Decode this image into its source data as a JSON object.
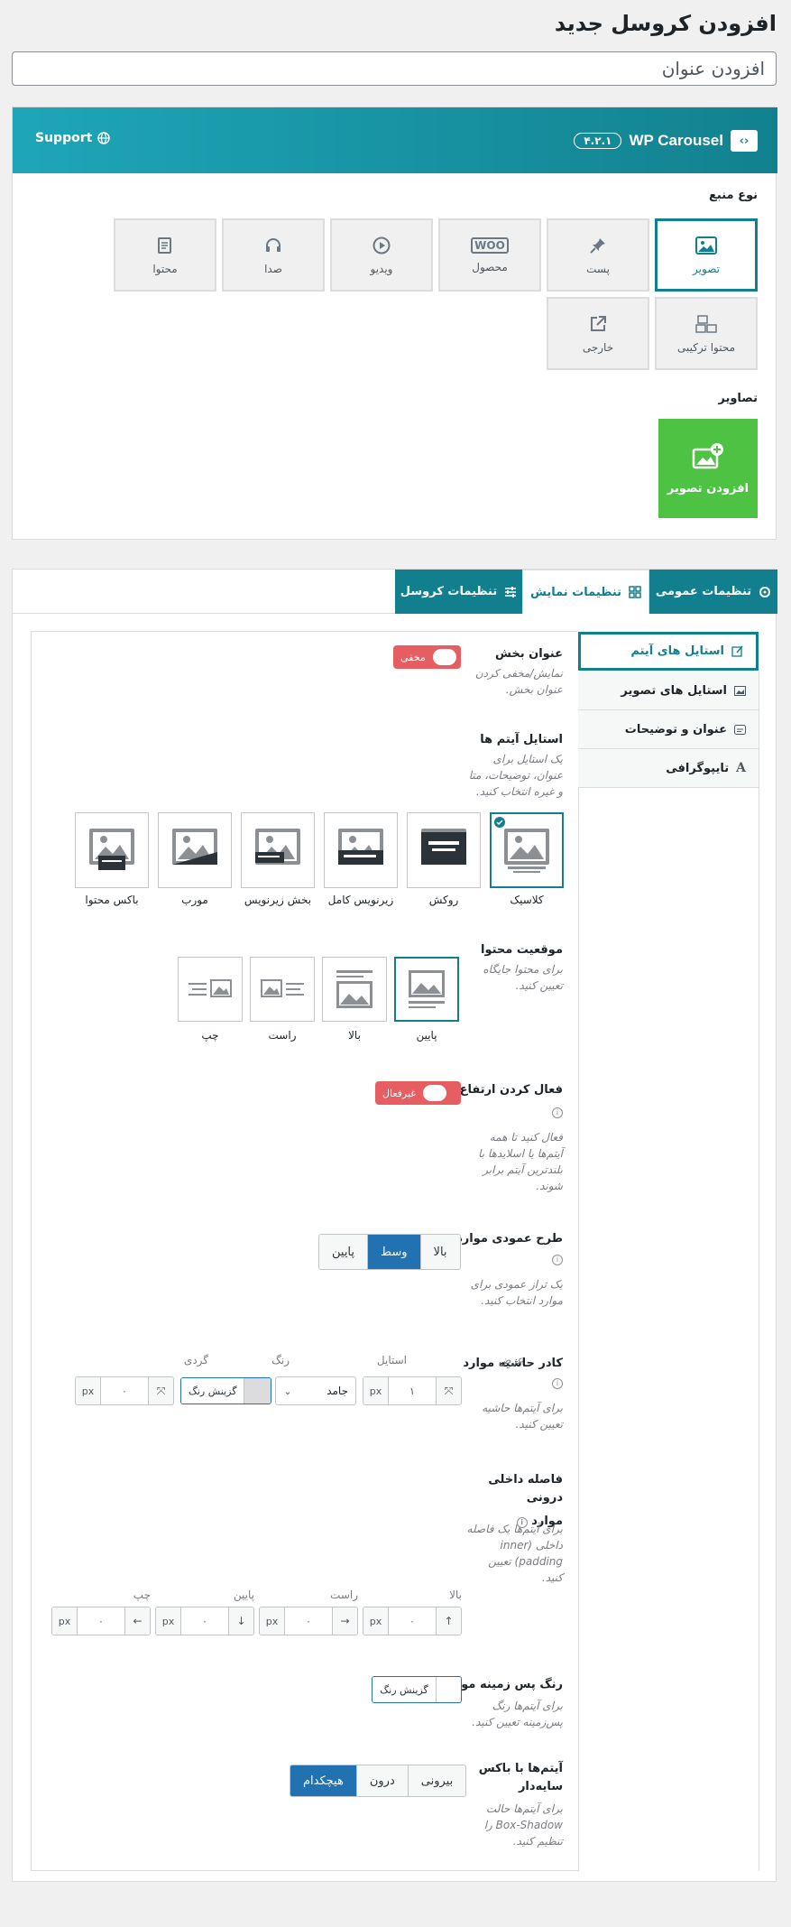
{
  "page": {
    "title": "افزودن کروسل جدید",
    "title_input_value": "افزودن عنوان"
  },
  "header": {
    "brand": "WP Carousel",
    "version": "۴.۲.۱",
    "support": "Support"
  },
  "source": {
    "label": "نوع منبع",
    "items": [
      {
        "label": "تصویر",
        "icon": "image-icon",
        "active": true
      },
      {
        "label": "پست",
        "icon": "pin-icon"
      },
      {
        "label": "محصول",
        "icon": "woo-icon",
        "icon_text": "WOO"
      },
      {
        "label": "ویدیو",
        "icon": "play-icon"
      },
      {
        "label": "صدا",
        "icon": "headphones-icon"
      },
      {
        "label": "محتوا",
        "icon": "content-icon"
      },
      {
        "label": "محتوا ترکیبی",
        "icon": "mixed-content-icon"
      },
      {
        "label": "خارجی",
        "icon": "external-link-icon"
      }
    ],
    "images_label": "تصاویر",
    "add_image": "افزودن تصویر"
  },
  "tabs": [
    {
      "label": "تنظیمات عمومی",
      "icon": "gear-icon"
    },
    {
      "label": "تنظیمات نمایش",
      "icon": "grid-icon",
      "active": true
    },
    {
      "label": "تنظیمات کروسل",
      "icon": "sliders-icon"
    }
  ],
  "sidebar": [
    {
      "label": "استایل های آیتم",
      "icon": "edit-icon",
      "active": true
    },
    {
      "label": "استایل های تصویر",
      "icon": "image-icon"
    },
    {
      "label": "عنوان و توضیحات",
      "icon": "caption-icon"
    },
    {
      "label": "تایپوگرافی",
      "icon": "typography-icon",
      "icon_text": "A"
    }
  ],
  "section_title": {
    "label": "عنوان بخش",
    "desc": [
      "نمایش/مخفی کردن",
      "عنوان بخش."
    ],
    "toggle": "مخفی"
  },
  "item_styles": {
    "label": "استایل آیتم ها",
    "desc": [
      "یک استایل برای",
      "عنوان، توضیحات، متا",
      "و غیره انتخاب کنید."
    ],
    "options": [
      "کلاسیک",
      "روکش",
      "زیرنویس کامل",
      "بخش زیرنویس",
      "مورب",
      "باکس محتوا"
    ]
  },
  "content_position": {
    "label": "موقعیت محتوا",
    "desc": [
      "برای محتوا جایگاه",
      "تعیین کنید."
    ],
    "options": [
      "پایین",
      "بالا",
      "راست",
      "چپ"
    ]
  },
  "equal_height": {
    "label": "فعال کردن ارتفاع برابر",
    "toggle": "غیرفعال",
    "desc": [
      "فعال کنید تا همه",
      "آیتم‌ها یا اسلایدها با",
      "بلندترین آیتم برابر",
      "شوند."
    ]
  },
  "vertical_align": {
    "label": "طرح عمودی موارد",
    "options": [
      "بالا",
      "وسط",
      "پایین"
    ],
    "selected": "وسط",
    "desc": [
      "یک تراز عمودی برای",
      "موارد انتخاب کنید."
    ]
  },
  "border": {
    "label": "کادر حاشیه موارد",
    "desc": [
      "برای آیتم‌ها حاشیه",
      "تعیین کنید."
    ],
    "width_label": "عرض",
    "width_value": "۱",
    "unit": "px",
    "style_label": "استایل",
    "style_value": "جامد",
    "color_label": "رنگ",
    "color_button": "گزینش رنگ",
    "radius_label": "گردی",
    "radius_value": "۰"
  },
  "padding": {
    "label": [
      "فاصله داخلی درونی",
      "موارد"
    ],
    "desc": [
      "برای آیتم‌ها یک فاصله",
      "داخلی (inner",
      "padding) تعیین",
      "کنید."
    ],
    "fields": [
      {
        "label": "بالا",
        "value": "۰",
        "unit": "px",
        "arrow": "↑"
      },
      {
        "label": "راست",
        "value": "۰",
        "unit": "px",
        "arrow": "→"
      },
      {
        "label": "پایین",
        "value": "۰",
        "unit": "px",
        "arrow": "↓"
      },
      {
        "label": "چپ",
        "value": "۰",
        "unit": "px",
        "arrow": "←"
      }
    ]
  },
  "background": {
    "label": "رنگ پس زمینه مورد",
    "color_button": "گزینش رنگ",
    "desc": [
      "برای آیتم‌ها رنگ",
      "پس‌زمینه تعیین کنید."
    ]
  },
  "shadow": {
    "label": [
      "آیتم‌ها با باکس",
      "سایه‌دار"
    ],
    "options": [
      "بیرونی",
      "درون",
      "هیچکدام"
    ],
    "selected": "هیچکدام",
    "desc": [
      "برای آیتم‌ها حالت",
      "Box-Shadow را",
      "تنظیم کنید."
    ]
  },
  "colors": {
    "accent": "#117f8d",
    "green": "#4ec343",
    "toggle": "#e65d62",
    "blue": "#2271b1"
  }
}
